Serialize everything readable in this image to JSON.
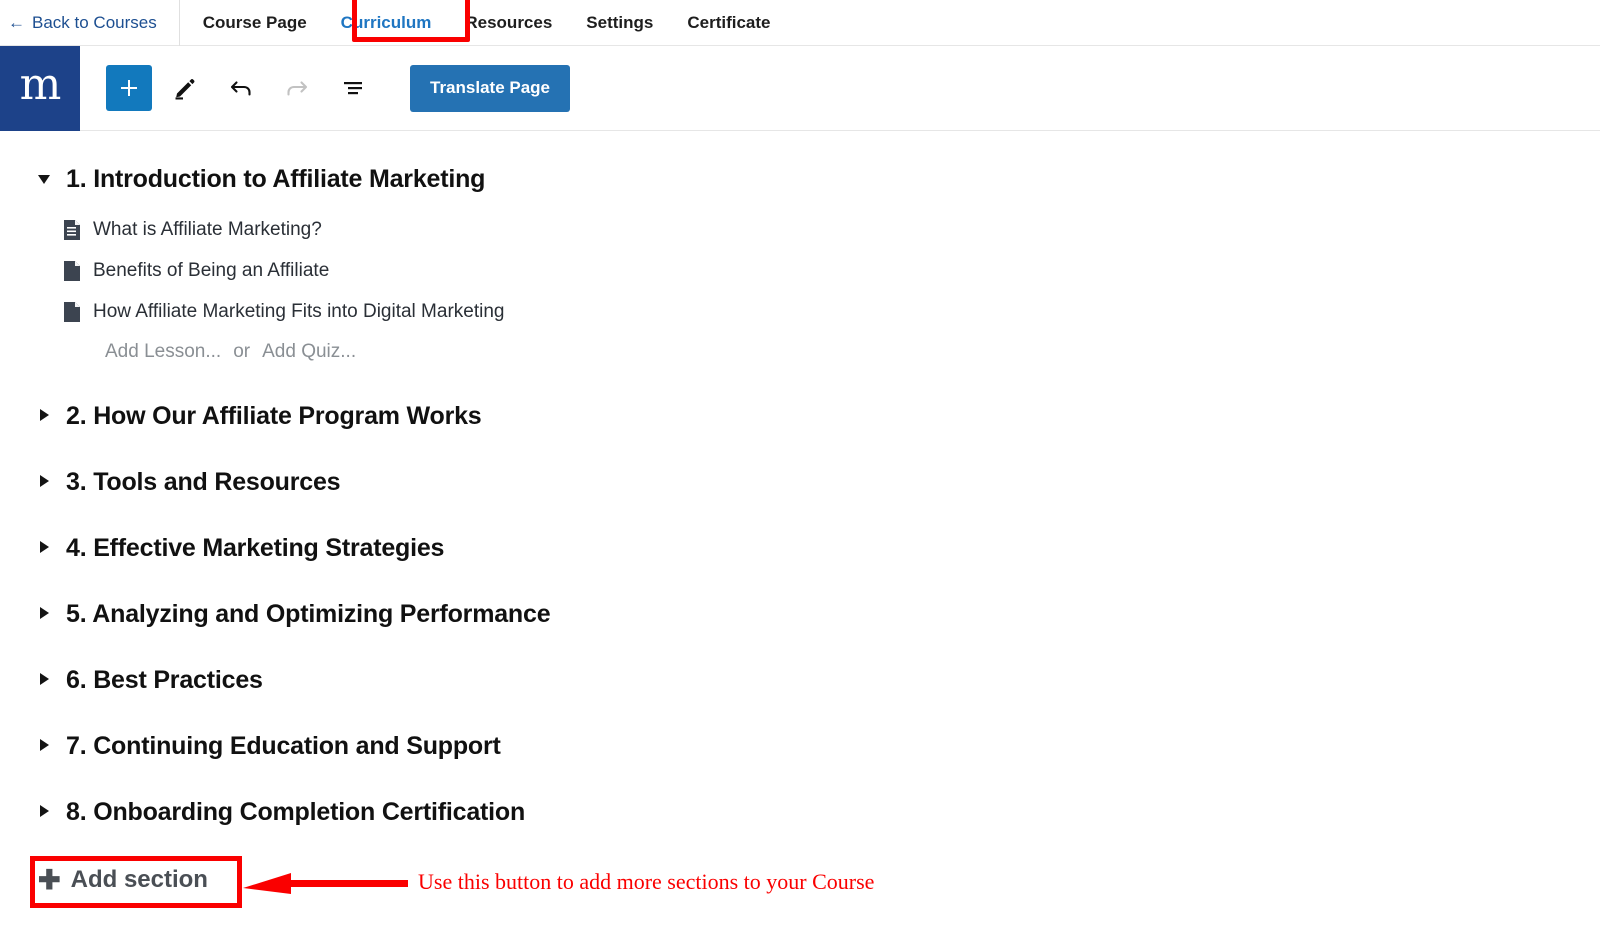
{
  "topbar": {
    "back_label": "Back to Courses",
    "back_arrow_glyph": "←",
    "tabs": [
      {
        "label": "Course Page",
        "active": false
      },
      {
        "label": "Curriculum",
        "active": true
      },
      {
        "label": "Resources",
        "active": false
      },
      {
        "label": "Settings",
        "active": false
      },
      {
        "label": "Certificate",
        "active": false
      }
    ]
  },
  "toolbar": {
    "logo_mark": "m",
    "add_block_icon": "plus-icon",
    "edit_icon": "pencil-icon",
    "undo_icon": "undo-arrow-icon",
    "redo_icon": "redo-arrow-icon",
    "details_icon": "list-view-icon",
    "translate_label": "Translate Page"
  },
  "curriculum": {
    "sections": [
      {
        "title": "1. Introduction to Affiliate Marketing",
        "expanded": true,
        "lessons": [
          {
            "label": "What is Affiliate Marketing?",
            "icon": "document-lines-icon"
          },
          {
            "label": "Benefits of Being an Affiliate",
            "icon": "document-icon"
          },
          {
            "label": "How Affiliate Marketing Fits into Digital Marketing",
            "icon": "document-icon"
          }
        ],
        "add_lesson_placeholder": "Add Lesson...",
        "add_or": "or",
        "add_quiz_placeholder": "Add Quiz..."
      },
      {
        "title": "2. How Our Affiliate Program Works",
        "expanded": false
      },
      {
        "title": "3. Tools and Resources",
        "expanded": false
      },
      {
        "title": "4. Effective Marketing Strategies",
        "expanded": false
      },
      {
        "title": "5. Analyzing and Optimizing Performance",
        "expanded": false
      },
      {
        "title": "6. Best Practices",
        "expanded": false
      },
      {
        "title": "7. Continuing Education and Support",
        "expanded": false
      },
      {
        "title": "8. Onboarding Completion Certification",
        "expanded": false
      }
    ]
  },
  "add_section": {
    "label": "Add section",
    "plus_glyph": "✚"
  },
  "annotation": {
    "text": "Use this button to add more sections to your Course",
    "color": "#fa0000"
  },
  "colors": {
    "logo_background": "#1d4289",
    "primary_button": "#1279bd",
    "translate_button": "#2572b3",
    "active_tab": "#1f76c2",
    "back_link": "#1d4f91",
    "annotation_red": "#fa0000"
  }
}
